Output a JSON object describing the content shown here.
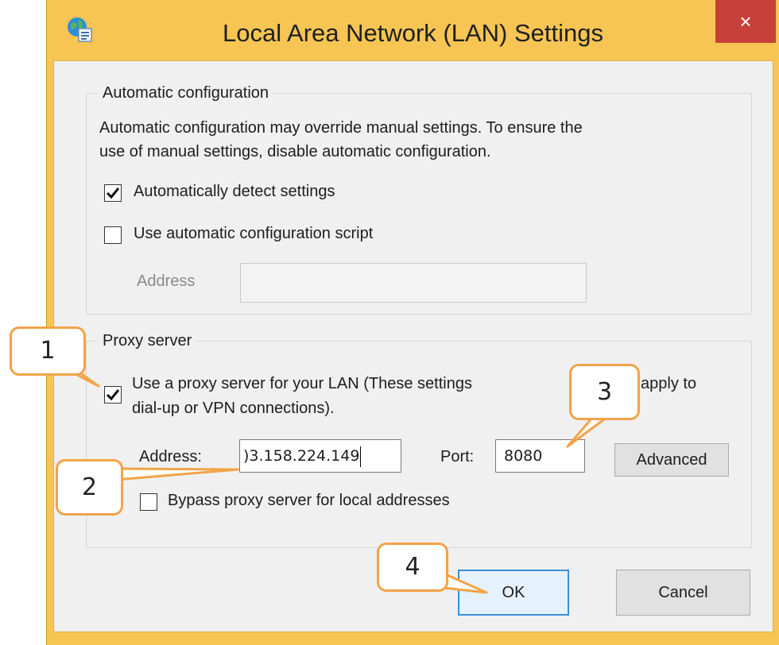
{
  "dialog": {
    "title": "Local Area Network (LAN) Settings",
    "close_label": "×"
  },
  "automatic_configuration": {
    "legend": "Automatic configuration",
    "description_line1": "Automatic configuration may override manual settings.  To ensure the",
    "description_line2": "use of manual settings, disable automatic configuration.",
    "auto_detect": {
      "label": "Automatically detect settings",
      "checked": true
    },
    "use_script": {
      "label": "Use automatic configuration script",
      "checked": false
    },
    "address_label": "Address",
    "address_value": ""
  },
  "proxy_server": {
    "legend": "Proxy server",
    "use_proxy": {
      "label_line1": "Use a proxy server for your LAN (These settings",
      "label_line1_end": "apply to",
      "label_line2": "dial-up or VPN connections).",
      "checked": true
    },
    "address_label": "Address:",
    "address_value": ")3.158.224.149",
    "port_label": "Port:",
    "port_value": "8080",
    "advanced_label": "Advanced",
    "bypass": {
      "label": "Bypass proxy server for local addresses",
      "checked": false
    }
  },
  "buttons": {
    "ok": "OK",
    "cancel": "Cancel"
  },
  "callouts": [
    "1",
    "2",
    "3",
    "4"
  ],
  "colors": {
    "frame": "#f6c553",
    "callout_border": "#f2a348",
    "close": "#c7413a",
    "accent": "#3c8fd8"
  }
}
